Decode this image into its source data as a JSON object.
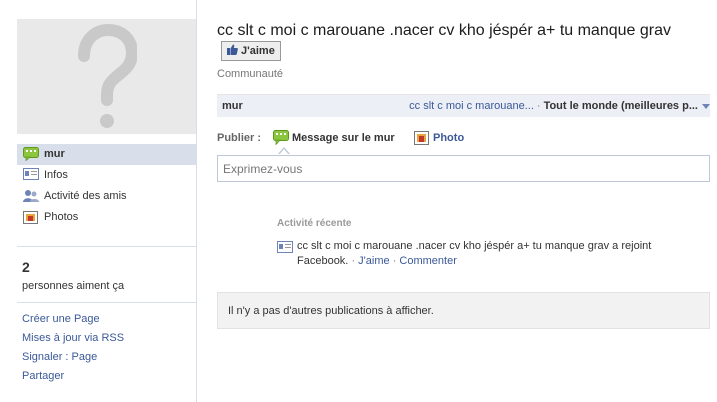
{
  "sidebar": {
    "nav": [
      {
        "label": "mur",
        "icon": "wall-icon",
        "selected": true
      },
      {
        "label": "Infos",
        "icon": "info-icon",
        "selected": false
      },
      {
        "label": "Activité des amis",
        "icon": "friends-icon",
        "selected": false
      },
      {
        "label": "Photos",
        "icon": "photos-icon",
        "selected": false
      }
    ],
    "likes_count": "2",
    "likes_label": "personnes aiment ça",
    "links": [
      "Créer une Page",
      "Mises à jour via RSS",
      "Signaler : Page",
      "Partager"
    ]
  },
  "header": {
    "title": "cc slt c moi c marouane .nacer cv kho jéspér a+ tu manque grav",
    "like_button": "J'aime",
    "subtitle": "Communauté"
  },
  "filter_bar": {
    "left": "mur",
    "page_link": "cc slt c moi c marouane...",
    "separator": "·",
    "audience": "Tout le monde (meilleures p..."
  },
  "publisher": {
    "label": "Publier :",
    "status": "Message sur le mur",
    "photo": "Photo",
    "placeholder": "Exprimez-vous"
  },
  "recent": {
    "title": "Activité récente",
    "text_line1": "cc slt c moi c marouane .nacer cv kho jéspér a+ tu manque grav a rejoint",
    "text_line2": "Facebook.",
    "dot": "·",
    "like": "J'aime",
    "comment": "Commenter"
  },
  "no_more": "Il n'y a pas d'autres publications à afficher.",
  "colors": {
    "accent": "#3b5998",
    "selected_bg": "#d8dfea"
  }
}
